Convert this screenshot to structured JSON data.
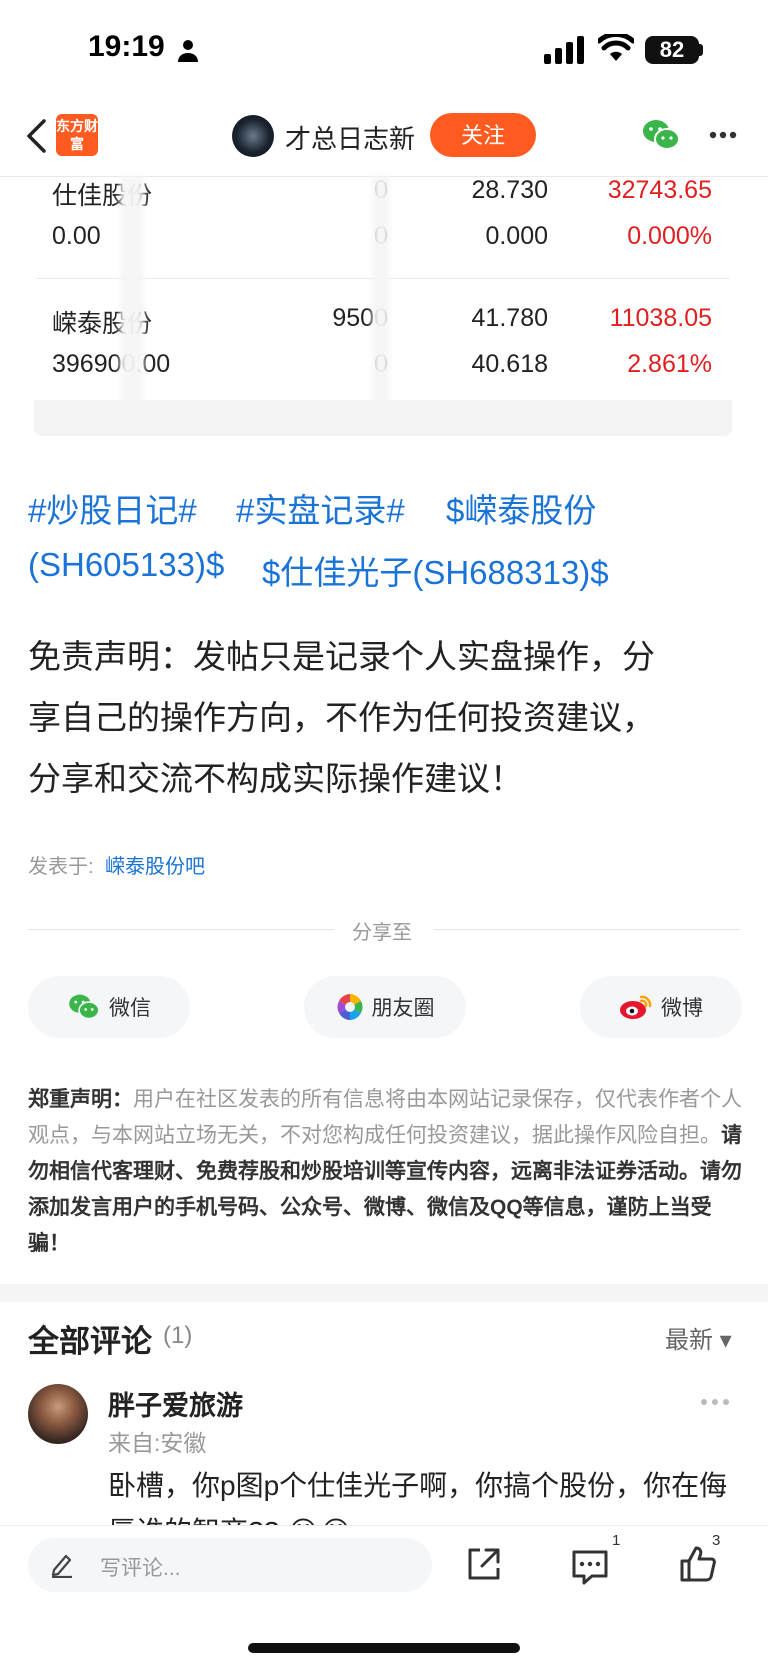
{
  "status_bar": {
    "time": "19:19",
    "battery": "82"
  },
  "nav": {
    "logo": "东方财富",
    "title": "才总日志新",
    "follow": "关注"
  },
  "stock_table": {
    "rows": [
      {
        "name": "仕佳股份",
        "qty": "0",
        "price": "28.730",
        "value": "32743.65",
        "cost": "0.00",
        "qty2": "0",
        "price2": "0.000",
        "pct": "0.000%"
      },
      {
        "name": "嵘泰股份",
        "qty": "9500",
        "price": "41.780",
        "value": "11038.05",
        "cost": "396900.00",
        "qty2": "0",
        "price2": "40.618",
        "pct": "2.861%"
      }
    ]
  },
  "tags": {
    "line1": [
      "#炒股日记#",
      "#实盘记录#",
      "$嵘泰股份"
    ],
    "line2": [
      "(SH605133)$",
      "$仕佳光子(SH688313)$"
    ]
  },
  "body": {
    "lines": [
      "免责声明：发帖只是记录个人实盘操作，分",
      "享自己的操作方向，不作为任何投资建议，",
      "分享和交流不构成实际操作建议！"
    ]
  },
  "posted": {
    "label": "发表于:",
    "forum": "嵘泰股份吧"
  },
  "share": {
    "label": "分享至",
    "wechat": "微信",
    "moments": "朋友圈",
    "weibo": "微博"
  },
  "disclaimer": {
    "title": "郑重声明：",
    "normal": "用户在社区发表的所有信息将由本网站记录保存，仅代表作者个人观点，与本网站立场无关，不对您构成任何投资建议，据此操作风险自担。",
    "strong": "请勿相信代客理财、免费荐股和炒股培训等宣传内容，远离非法证券活动。请勿添加发言用户的手机号码、公众号、微博、微信及QQ等信息，谨防上当受骗！"
  },
  "comments": {
    "title": "全部评论",
    "count": "(1)",
    "sort": "最新 ▾",
    "items": [
      {
        "name": "胖子爱旅游",
        "location": "来自:安徽",
        "text": "卧槽，你p图p个仕佳光子啊，你搞个股份，你在侮辱谁的智商?? 😂😂"
      }
    ]
  },
  "bottom_bar": {
    "placeholder": "写评论...",
    "comment_badge": "1",
    "like_badge": "3"
  },
  "colors": {
    "accent": "#ff5a1f",
    "link": "#1a73d6",
    "red": "#e02020"
  }
}
